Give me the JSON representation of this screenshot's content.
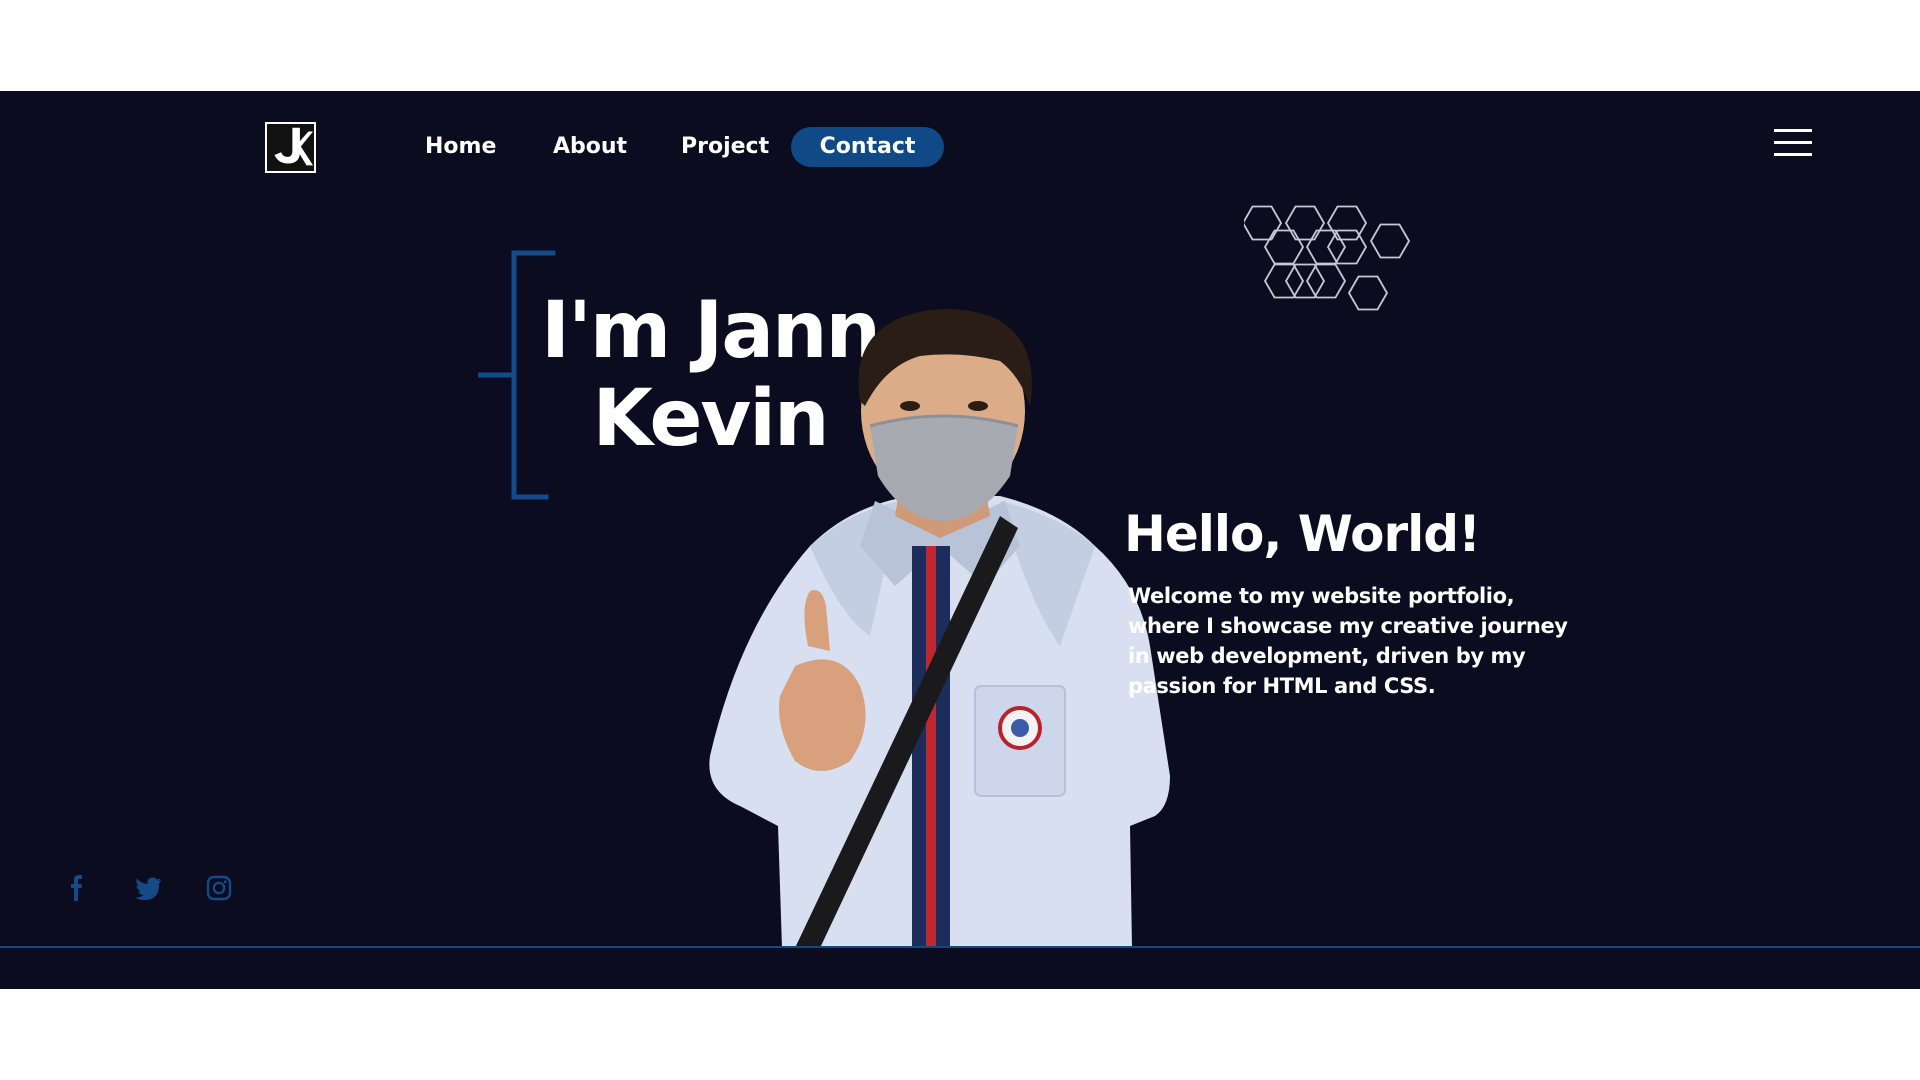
{
  "nav": {
    "logo_icon": "jk-logo",
    "links": [
      {
        "label": "Home"
      },
      {
        "label": "About"
      },
      {
        "label": "Project"
      },
      {
        "label": "Contact"
      }
    ],
    "menu_icon": "hamburger-menu-icon"
  },
  "hero": {
    "name_line1": "I'm Jann",
    "name_line2": "Kevin"
  },
  "intro": {
    "title": "Hello, World!",
    "text": "Welcome to my website portfolio, where I showcase my creative journey in web development, driven by my passion for HTML and CSS."
  },
  "social": [
    {
      "icon": "facebook-icon"
    },
    {
      "icon": "twitter-icon"
    },
    {
      "icon": "instagram-icon"
    }
  ],
  "colors": {
    "background": "#0c0c20",
    "accent": "#0f4a87",
    "bracket": "#134a8a",
    "text": "#ffffff"
  }
}
